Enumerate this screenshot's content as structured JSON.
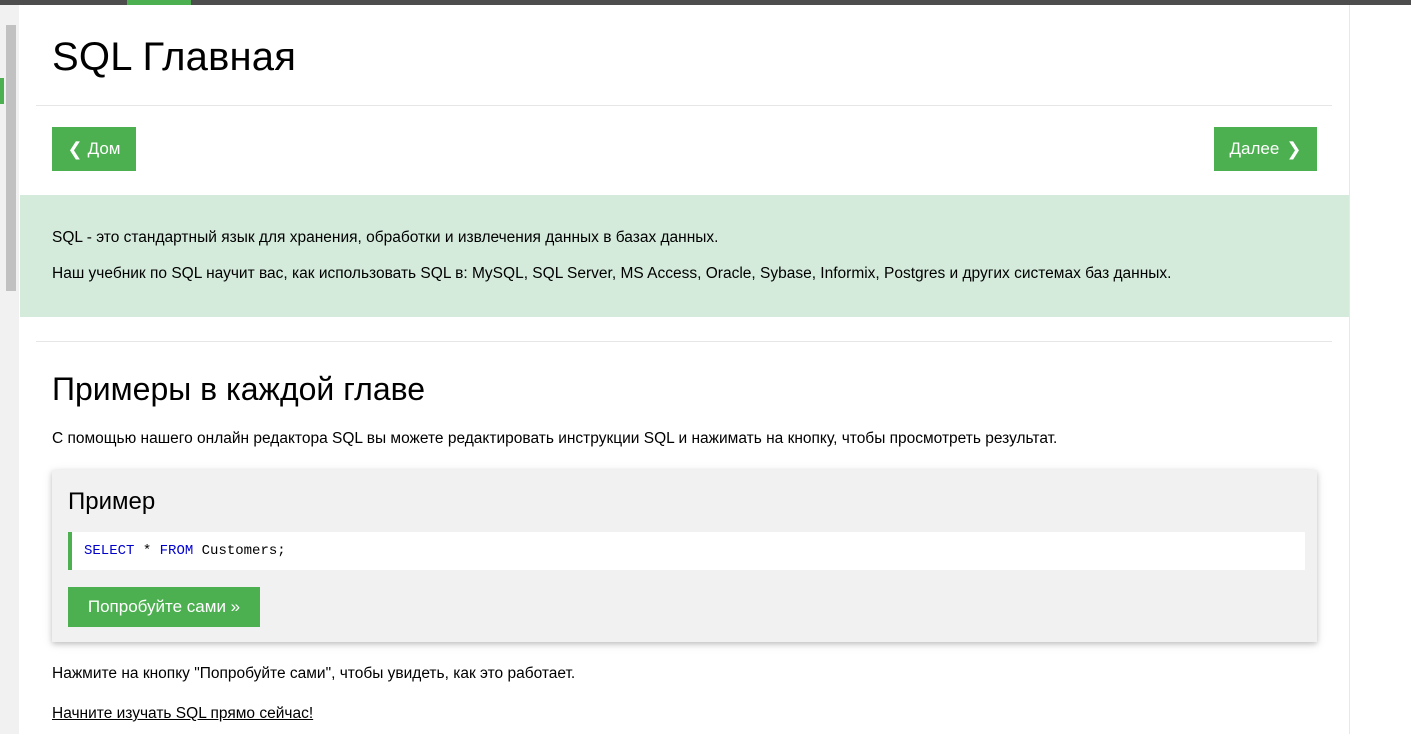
{
  "page": {
    "title": "SQL Главная"
  },
  "nav": {
    "prev_icon": "chevron-left",
    "prev_glyph": "❮",
    "prev_label": "Дом",
    "next_label": "Далее",
    "next_icon": "chevron-right",
    "next_glyph": "❯"
  },
  "intro": {
    "line1": "SQL - это стандартный язык для хранения, обработки и извлечения данных в базах данных.",
    "line2": "Наш учебник по SQL научит вас, как использовать SQL в: MySQL, SQL Server, MS Access, Oracle, Sybase, Informix, Postgres и других системах баз данных."
  },
  "section": {
    "title": "Примеры в каждой главе",
    "text": "С помощью нашего онлайн редактора SQL вы можете редактировать инструкции SQL и нажимать на кнопку, чтобы просмотреть результат."
  },
  "example": {
    "heading": "Пример",
    "code": {
      "kw1": "SELECT",
      "mid": " * ",
      "kw2": "FROM",
      "rest": " Customers;"
    },
    "try_button": "Попробуйте сами »"
  },
  "footer": {
    "note": "Нажмите на кнопку \"Попробуйте сами\", чтобы увидеть, как это работает.",
    "start_link": "Начните изучать SQL прямо сейчас!"
  },
  "colors": {
    "accent": "#4caf50",
    "intro_bg": "#d4ebdc",
    "example_bg": "#f1f1f1",
    "keyword": "#0000cd",
    "top_bar": "#4d4d4d"
  }
}
